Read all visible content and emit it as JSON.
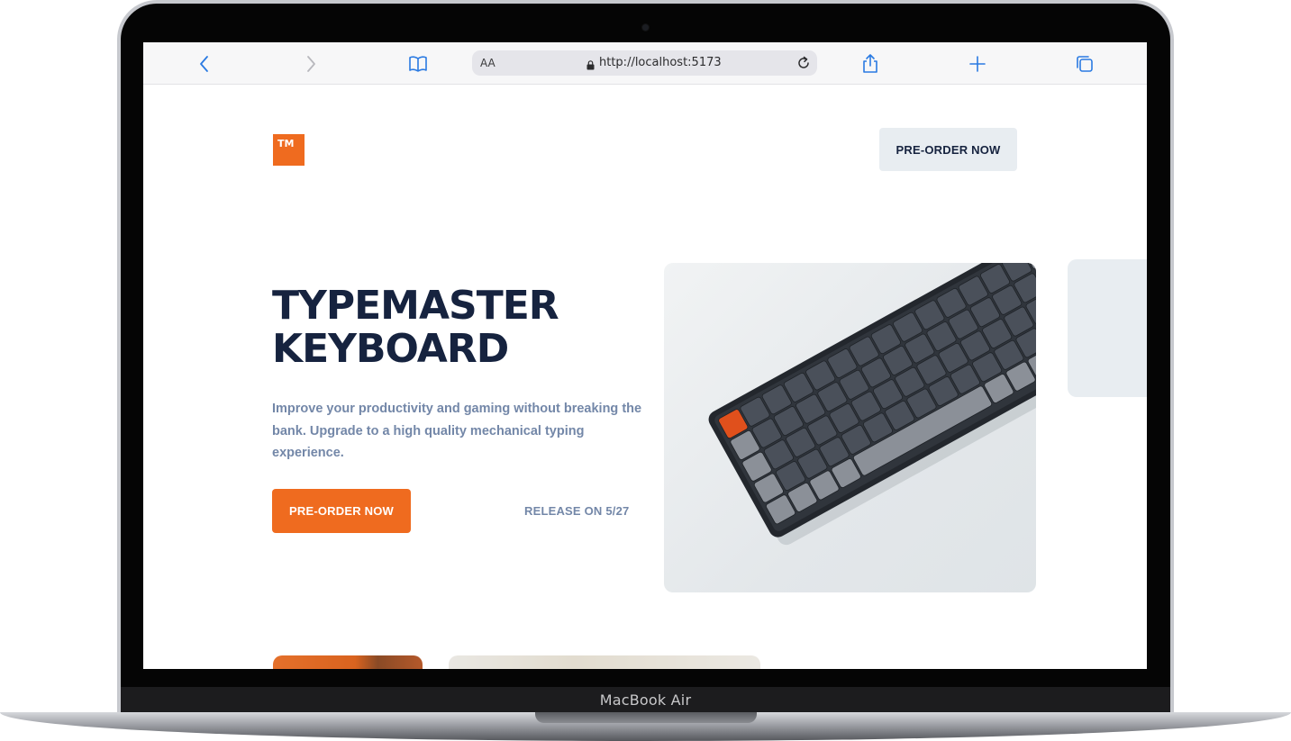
{
  "device": {
    "model_label": "MacBook Air"
  },
  "browser": {
    "text_size_label": "AA",
    "url": "http://localhost:5173",
    "icons": {
      "back": "chevron-left-icon",
      "forward": "chevron-right-icon",
      "bookmarks": "book-icon",
      "lock": "lock-icon",
      "reload": "reload-icon",
      "share": "share-icon",
      "new_tab": "plus-icon",
      "tabs": "tabs-icon"
    },
    "accent_color": "#2a7ae2"
  },
  "page": {
    "logo_text": "TM",
    "nav_preorder_label": "PRE-ORDER NOW",
    "hero": {
      "title_line1": "TYPEMASTER",
      "title_line2": "KEYBOARD",
      "description": "Improve your productivity and gaming without breaking the bank. Upgrade to a high quality mechanical typing experience.",
      "cta_label": "PRE-ORDER NOW",
      "release_text": "RELEASE ON 5/27"
    },
    "colors": {
      "brand_orange": "#ef6b1f",
      "navy": "#16233f",
      "muted_blue": "#7387a8",
      "light_gray": "#e8edf1"
    }
  }
}
